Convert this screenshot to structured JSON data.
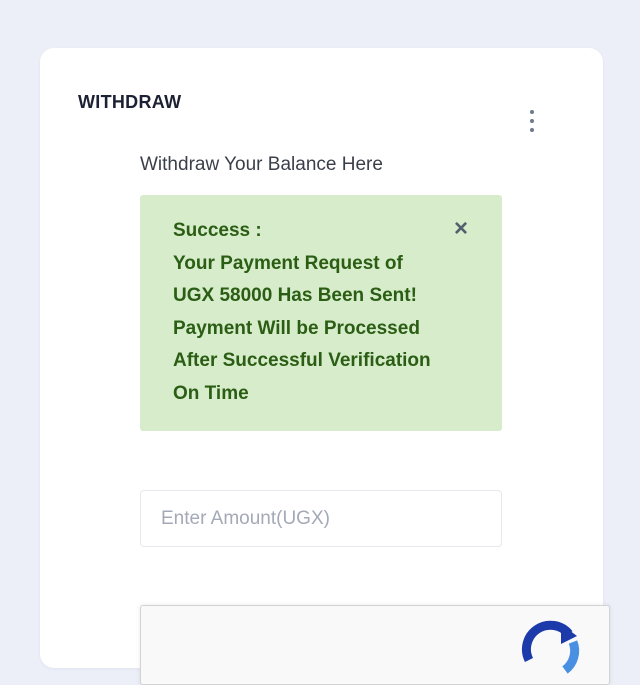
{
  "card": {
    "title": "WITHDRAW",
    "subtitle": "Withdraw Your Balance Here"
  },
  "menu": {
    "icon": "vertical-ellipsis-icon"
  },
  "alert": {
    "type": "success",
    "lines": [
      "Success :",
      "Your Payment Request of",
      "UGX 58000 Has Been Sent!",
      "Payment Will be Processed",
      "After Successful Verification",
      "On Time"
    ],
    "close_symbol": "×",
    "close_icon": "close-icon",
    "background_color": "#d6ecca",
    "text_color": "#2b5e14"
  },
  "amount": {
    "placeholder": "Enter Amount(UGX)",
    "value": ""
  },
  "captcha": {
    "icon": "recaptcha-icon"
  },
  "colors": {
    "page_background": "#eceff8",
    "card_background": "#ffffff"
  }
}
